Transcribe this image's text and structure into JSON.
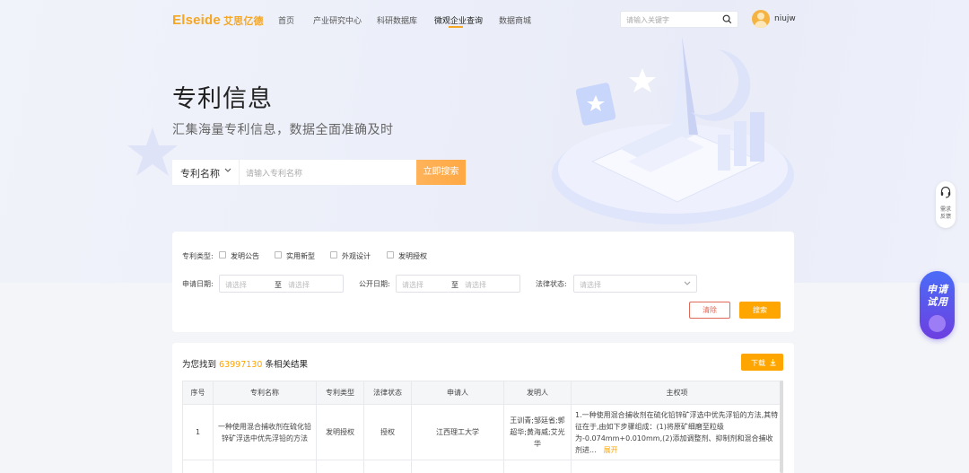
{
  "nav": {
    "logo_en": "Elseide",
    "logo_cn": "艾思亿德",
    "items": [
      "首页",
      "产业研究中心",
      "科研数据库",
      "微观企业查询",
      "数据商城"
    ],
    "search_placeholder": "请输入关键字",
    "username": "niujw"
  },
  "hero": {
    "title": "专利信息",
    "subtitle": "汇集海量专利信息，数据全面准确及时",
    "search_type": "专利名称",
    "search_placeholder": "请输入专利名称",
    "search_button": "立即搜索"
  },
  "filter": {
    "type_label": "专利类型:",
    "types": [
      "发明公告",
      "实用新型",
      "外观设计",
      "发明授权"
    ],
    "apply_date_label": "申请日期:",
    "publish_date_label": "公开日期:",
    "status_label": "法律状态:",
    "select_placeholder": "请选择",
    "to_label": "至",
    "clear_button": "清除",
    "search_button": "搜索"
  },
  "results": {
    "prefix": "为您找到",
    "count": "63997130",
    "suffix": "条相关结果",
    "download_button": "下载",
    "columns": [
      "序号",
      "专利名称",
      "专利类型",
      "法律状态",
      "申请人",
      "发明人",
      "主权项"
    ],
    "rows": [
      {
        "index": "1",
        "name": "一种使用混合捕收剂在硫化铅锌矿浮选中优先浮铅的方法",
        "type": "发明授权",
        "status": "授权",
        "applicant": "江西理工大学",
        "inventor": "王训青;邹廷省;郭超华;黄海威;艾光华",
        "claim": "1.一种使用混合捕收剂在硫化铅锌矿浮选中优先浮铅的方法,其特征在于,由如下步骤组成：(1)将原矿细磨至粒级为-0.074mm+0.010mm,(2)添加调整剂、抑制剂和混合捕收剂进...",
        "expand": "展开"
      }
    ]
  },
  "side": {
    "feedback": "需求反馈",
    "trial": "申请试用"
  },
  "colors": {
    "accent": "#ffa500",
    "danger": "#e06a5a",
    "trial": "#5a55ee"
  }
}
